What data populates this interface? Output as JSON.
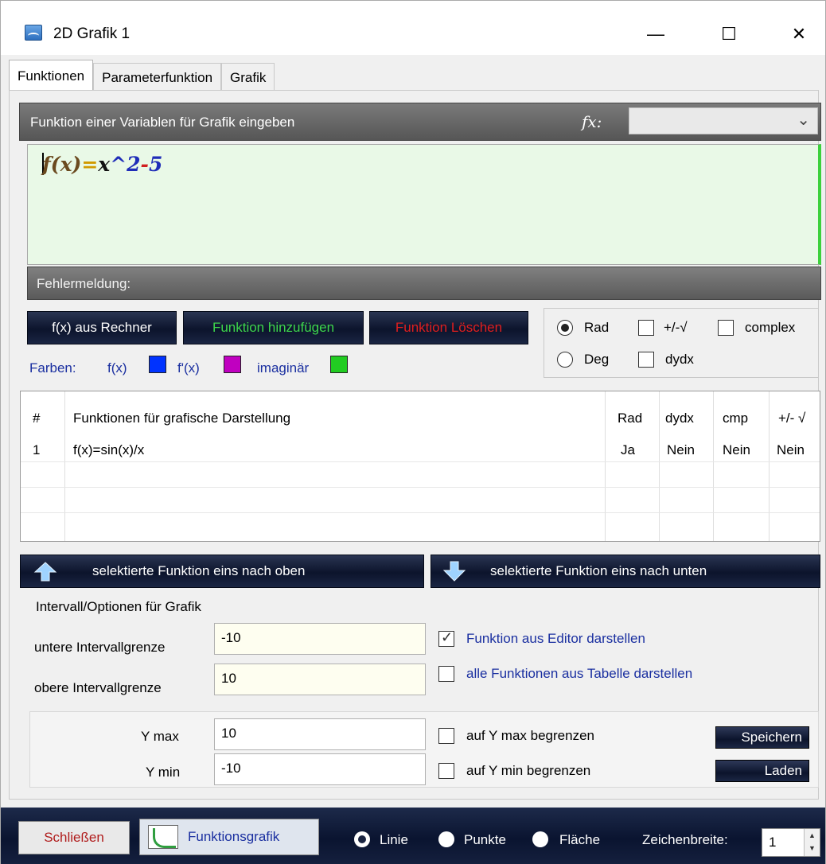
{
  "window": {
    "title": "2D Grafik 1",
    "minimize": "—",
    "maximize": "☐",
    "close": "✕"
  },
  "tabs": [
    "Funktionen",
    "Parameterfunktion",
    "Grafik"
  ],
  "editor": {
    "header_label": "Funktion einer Variablen für Grafik eingeben",
    "fx_label": "fx:",
    "fx_select_value": "",
    "formula": {
      "f": "f(x)",
      "eq": "=",
      "x": "x",
      "pow": "^",
      "n2": "2",
      "minus": "-",
      "n5": "5"
    },
    "error_label": "Fehlermeldung:"
  },
  "buttons": {
    "from_calculator": "f(x) aus Rechner",
    "add_function": "Funktion hinzufügen",
    "delete_function": "Funktion Löschen"
  },
  "colors": {
    "label": "Farben:",
    "fx_label": "f(x)",
    "dfx_label": "f'(x)",
    "imag_label": "imaginär",
    "fx_color": "#0033ff",
    "dfx_color": "#c000c0",
    "imag_color": "#22cc22"
  },
  "options": {
    "rad": "Rad",
    "deg": "Deg",
    "plusminus": "+/-√",
    "complex": "complex",
    "dydx": "dydx"
  },
  "table": {
    "headers": [
      "#",
      "Funktionen für grafische Darstellung",
      "Rad",
      "dydx",
      "cmp",
      "+/- √"
    ],
    "rows": [
      [
        "1",
        "f(x)=sin(x)/x",
        "Ja",
        "Nein",
        "Nein",
        "Nein"
      ]
    ]
  },
  "move": {
    "up": "selektierte Funktion eins nach oben",
    "down": "selektierte Funktion eins nach unten"
  },
  "interval": {
    "title": "Intervall/Optionen für Grafik",
    "lower_label": "untere Intervallgrenze",
    "lower_value": "-10",
    "upper_label": "obere Intervallgrenze",
    "upper_value": "10",
    "editor_check": "Funktion aus Editor darstellen",
    "all_check": "alle Funktionen aus Tabelle  darstellen",
    "ymax_label": "Y max",
    "ymax_value": "10",
    "ymin_label": "Y min",
    "ymin_value": "-10",
    "ymax_check": "auf Y max begrenzen",
    "ymin_check": "auf Y min begrenzen",
    "save": "Speichern",
    "load": "Laden"
  },
  "footer": {
    "close": "Schließen",
    "graph": "Funktionsgrafik",
    "line": "Linie",
    "points": "Punkte",
    "area": "Fläche",
    "width_label": "Zeichenbreite:",
    "width_value": "1"
  }
}
